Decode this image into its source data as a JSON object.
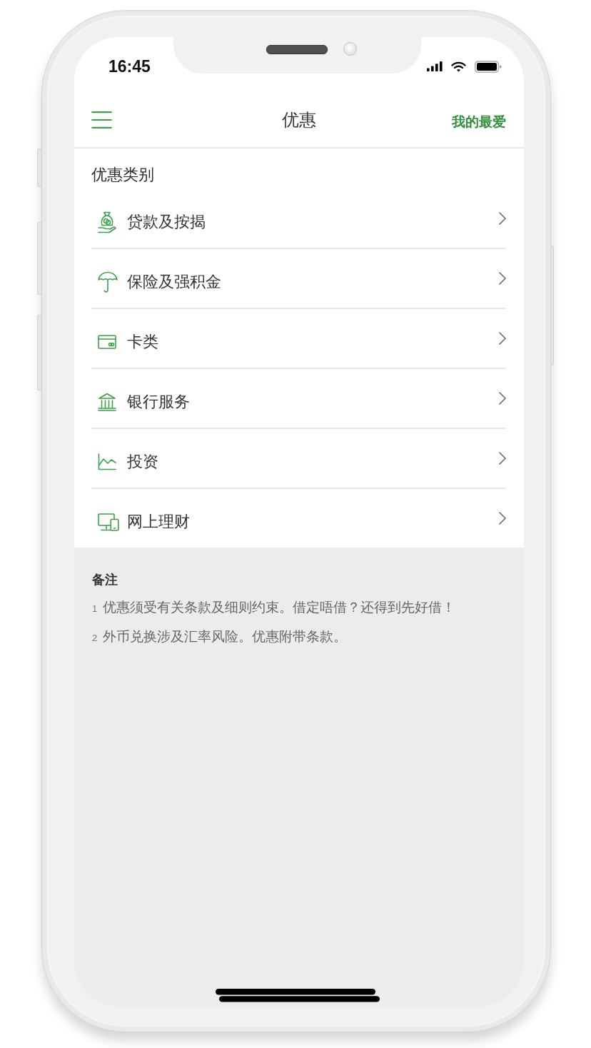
{
  "status_bar": {
    "time": "16:45"
  },
  "nav_bar": {
    "title": "优惠",
    "favorites": "我的最爱"
  },
  "categories": {
    "title": "优惠类别",
    "items": [
      {
        "label": "贷款及按揭"
      },
      {
        "label": "保险及强积金"
      },
      {
        "label": "卡类"
      },
      {
        "label": "银行服务"
      },
      {
        "label": "投资"
      },
      {
        "label": "网上理财"
      }
    ]
  },
  "notes": {
    "title": "备注",
    "items": [
      {
        "number": "1",
        "text": "优惠须受有关条款及细则约束。借定唔借？还得到先好借！"
      },
      {
        "number": "2",
        "text": "外币兑换涉及汇率风险。优惠附带条款。"
      }
    ]
  }
}
